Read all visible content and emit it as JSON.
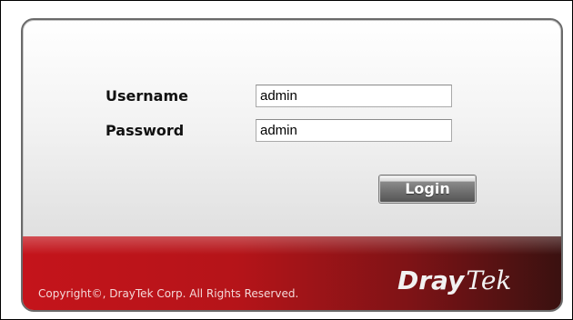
{
  "login": {
    "username_label": "Username",
    "username_value": "admin",
    "password_label": "Password",
    "password_value": "admin",
    "login_button": "Login"
  },
  "footer": {
    "copyright": "Copyright©, DrayTek Corp. All Rights Reserved.",
    "logo_part1": "Dray",
    "logo_part2": "Tek"
  },
  "colors": {
    "footer_red": "#c4141b",
    "footer_dark": "#3a1110",
    "button_gray": "#6f6f6f"
  }
}
